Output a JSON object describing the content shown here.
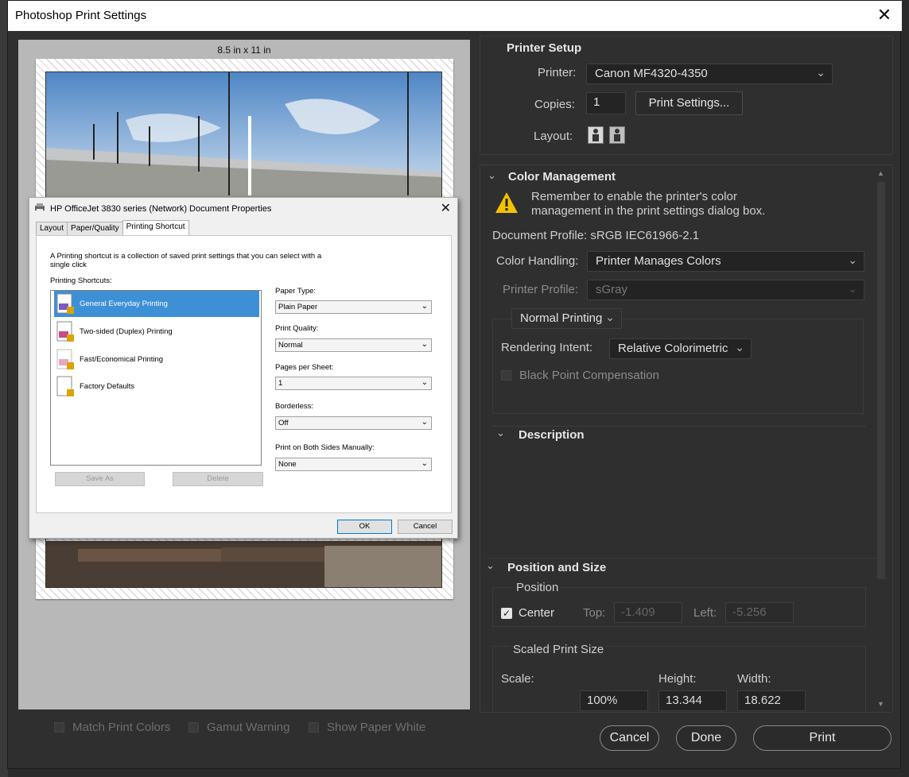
{
  "window": {
    "title": "Photoshop Print Settings"
  },
  "preview": {
    "paper_size": "8.5 in x 11 in"
  },
  "bottom_options": [
    {
      "label": "Match Print Colors"
    },
    {
      "label": "Gamut Warning"
    },
    {
      "label": "Show Paper White"
    }
  ],
  "printer_setup": {
    "title": "Printer Setup",
    "printer_label": "Printer:",
    "printer_value": "Canon MF4320-4350",
    "copies_label": "Copies:",
    "copies_value": "1",
    "print_settings_button": "Print Settings...",
    "layout_label": "Layout:"
  },
  "color_management": {
    "title": "Color Management",
    "warning": "Remember to enable the printer's color management in the print settings dialog box.",
    "document_profile": "Document Profile: sRGB IEC61966-2.1",
    "color_handling_label": "Color Handling:",
    "color_handling_value": "Printer Manages Colors",
    "printer_profile_label": "Printer Profile:",
    "printer_profile_value": "sGray",
    "print_mode": "Normal Printing",
    "rendering_intent_label": "Rendering Intent:",
    "rendering_intent_value": "Relative Colorimetric",
    "black_point": "Black Point Compensation"
  },
  "description": {
    "title": "Description"
  },
  "position_size": {
    "title": "Position and Size",
    "position_label": "Position",
    "center_label": "Center",
    "top_label": "Top:",
    "top_value": "-1.409",
    "left_label": "Left:",
    "left_value": "-5.256",
    "scaled_label": "Scaled Print Size",
    "scale_label": "Scale:",
    "scale_value": "100%",
    "height_label": "Height:",
    "height_value": "13.344",
    "width_label": "Width:",
    "width_value": "18.622"
  },
  "footer": {
    "cancel": "Cancel",
    "done": "Done",
    "print": "Print"
  },
  "hp_dialog": {
    "title": "HP OfficeJet 3830 series (Network) Document Properties",
    "tabs": [
      "Layout",
      "Paper/Quality",
      "Printing Shortcut"
    ],
    "description": "A Printing shortcut is a collection of saved print settings that you can select with a single click",
    "shortcuts_label": "Printing Shortcuts:",
    "shortcuts": [
      "General Everyday Printing",
      "Two-sided (Duplex) Printing",
      "Fast/Economical Printing",
      "Factory Defaults"
    ],
    "save_as": "Save As",
    "delete": "Delete",
    "paper_type_label": "Paper Type:",
    "paper_type_value": "Plain Paper",
    "print_quality_label": "Print Quality:",
    "print_quality_value": "Normal",
    "pages_per_sheet_label": "Pages per Sheet:",
    "pages_per_sheet_value": "1",
    "borderless_label": "Borderless:",
    "borderless_value": "Off",
    "both_sides_label": "Print on Both Sides Manually:",
    "both_sides_value": "None",
    "ok": "OK",
    "cancel": "Cancel"
  }
}
